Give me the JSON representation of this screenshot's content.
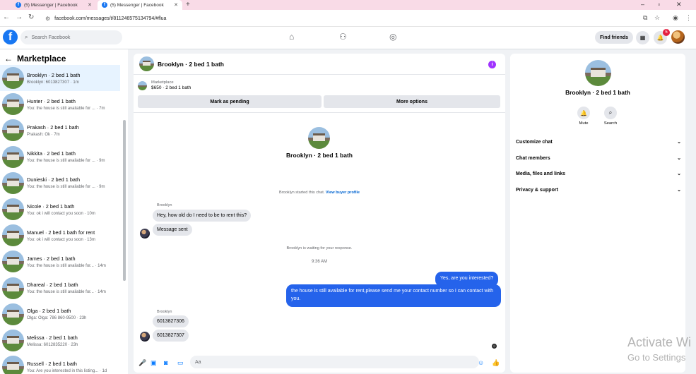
{
  "browser": {
    "tabs": [
      {
        "label": "(5) Messenger | Facebook"
      },
      {
        "label": "(5) Messenger | Facebook"
      }
    ],
    "new_tab": "+",
    "url": "facebook.com/messages/t/811246575134794/#flua",
    "controls": {
      "minimize": "–",
      "restore": "▫",
      "close": "✕"
    }
  },
  "header": {
    "logo": "f",
    "search_placeholder": "Search Facebook",
    "find_friends": "Find friends",
    "notification_count": "5"
  },
  "sidebar": {
    "title": "Marketplace",
    "conversations": [
      {
        "name": "Brooklyn · 2 bed 1 bath",
        "preview": "Brooklyn: 6013827307 · 1m",
        "active": true
      },
      {
        "name": "Hunter · 2 bed 1 bath",
        "preview": "You: the house is still available for ...  · 7m"
      },
      {
        "name": "Prakash · 2 bed 1 bath",
        "preview": "Prakash: Ok · 7m"
      },
      {
        "name": "Nikkita · 2 bed 1 bath",
        "preview": "You: the house is still available for ...  · 9m"
      },
      {
        "name": "Dunieski · 2 bed 1 bath",
        "preview": "You: the house is still available for ...  · 9m"
      },
      {
        "name": "Nicole · 2 bed 1 bath",
        "preview": "You: ok i will contact you soon · 10m"
      },
      {
        "name": "Manuel · 2 bed 1 bath for rent",
        "preview": "You: ok i will contact you soon · 13m"
      },
      {
        "name": "James · 2 bed 1 bath",
        "preview": "You: the house is still available for... · 14m"
      },
      {
        "name": "Dhareal · 2 bed 1 bath",
        "preview": "You: the house is still available for... · 14m"
      },
      {
        "name": "Olga · 2 bed 1 bath",
        "preview": "Olga: Olga: 786 860-9500 · 23h"
      },
      {
        "name": "Melissa · 2 bed 1 bath",
        "preview": "Melissa: 6012835220 · 23h"
      },
      {
        "name": "Russell · 2 bed 1 bath",
        "preview": "You: Are you interested in this listing... · 1d"
      }
    ]
  },
  "chat": {
    "title": "Brooklyn · 2 bed 1 bath",
    "marketplace_label": "Marketplace",
    "listing": "$650 · 2 bed 1 bath",
    "mark_pending": "Mark as pending",
    "more_options": "More options",
    "center_title": "Brooklyn · 2 bed 1 bath",
    "started_text": "Brooklyn started this chat.",
    "view_profile": "View buyer profile",
    "sender1": "Brooklyn",
    "msg1": "Hey, how old do I need to be to rent this?",
    "msg2": "Message sent",
    "waiting": "Brooklyn is waiting for your response.",
    "time": "9:36 AM",
    "out1": "Yes, are you interested?",
    "out2": "the house is still available for rent,please send me your contact number so I can contact with you.",
    "sender2": "Brooklyn",
    "msg3": "6013827306",
    "msg4": "6013827307",
    "composer_placeholder": "Aa"
  },
  "right_panel": {
    "title": "Brooklyn · 2 bed 1 bath",
    "mute": "Mute",
    "search": "Search",
    "items": [
      "Customize chat",
      "Chat members",
      "Media, files and links",
      "Privacy & support"
    ]
  },
  "watermark": {
    "line1": "Activate Wi",
    "line2": "Go to Settings"
  },
  "colors": {
    "brand": "#1877f2",
    "accent_out": "#2563eb",
    "active_row": "#e7f3ff"
  }
}
